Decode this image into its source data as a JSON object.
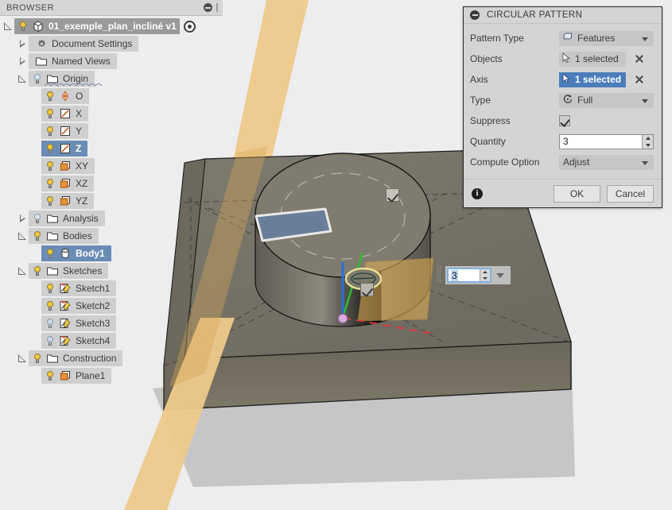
{
  "browser": {
    "header": {
      "title": "BROWSER",
      "minimize_icon": "minimize-icon",
      "grip_icon": "panel-grip-icon"
    },
    "tree": [
      {
        "label": "01_exemple_plan_incliné v1",
        "icon": "component-cube-icon",
        "state": "selected-root",
        "twisty": "open",
        "indent": 0,
        "bulb": "on",
        "eye": true
      },
      {
        "label": "Document Settings",
        "icon": "gear-icon",
        "twisty": "closed",
        "indent": 1,
        "bulb": "none"
      },
      {
        "label": "Named Views",
        "icon": "folder-icon",
        "twisty": "closed",
        "indent": 1,
        "bulb": "none"
      },
      {
        "label": "Origin",
        "icon": "folder-icon",
        "twisty": "open",
        "indent": 1,
        "bulb": "dim"
      },
      {
        "label": "O",
        "icon": "origin-point-icon",
        "twisty": "none",
        "indent": 2,
        "bulb": "on"
      },
      {
        "label": "X",
        "icon": "axis-icon",
        "twisty": "none",
        "indent": 2,
        "bulb": "on"
      },
      {
        "label": "Y",
        "icon": "axis-icon",
        "twisty": "none",
        "indent": 2,
        "bulb": "on"
      },
      {
        "label": "Z",
        "icon": "axis-icon",
        "twisty": "none",
        "indent": 2,
        "bulb": "on",
        "state": "selected"
      },
      {
        "label": "XY",
        "icon": "plane-icon",
        "twisty": "none",
        "indent": 2,
        "bulb": "on"
      },
      {
        "label": "XZ",
        "icon": "plane-icon",
        "twisty": "none",
        "indent": 2,
        "bulb": "on"
      },
      {
        "label": "YZ",
        "icon": "plane-icon",
        "twisty": "none",
        "indent": 2,
        "bulb": "on"
      },
      {
        "label": "Analysis",
        "icon": "folder-icon",
        "twisty": "closed",
        "indent": 1,
        "bulb": "dim"
      },
      {
        "label": "Bodies",
        "icon": "folder-icon",
        "twisty": "open",
        "indent": 1,
        "bulb": "on"
      },
      {
        "label": "Body1",
        "icon": "body-icon",
        "twisty": "none",
        "indent": 2,
        "bulb": "on",
        "state": "selected"
      },
      {
        "label": "Sketches",
        "icon": "folder-icon",
        "twisty": "open",
        "indent": 1,
        "bulb": "on"
      },
      {
        "label": "Sketch1",
        "icon": "sketch-icon",
        "twisty": "none",
        "indent": 2,
        "bulb": "on"
      },
      {
        "label": "Sketch2",
        "icon": "sketch-icon",
        "twisty": "none",
        "indent": 2,
        "bulb": "on"
      },
      {
        "label": "Sketch3",
        "icon": "sketch-icon",
        "twisty": "none",
        "indent": 2,
        "bulb": "off"
      },
      {
        "label": "Sketch4",
        "icon": "sketch-icon",
        "twisty": "none",
        "indent": 2,
        "bulb": "off"
      },
      {
        "label": "Construction",
        "icon": "folder-icon",
        "twisty": "open",
        "indent": 1,
        "bulb": "on"
      },
      {
        "label": "Plane1",
        "icon": "plane-icon",
        "twisty": "none",
        "indent": 2,
        "bulb": "on"
      }
    ]
  },
  "dialog": {
    "title": "CIRCULAR PATTERN",
    "collapse_icon": "collapse-icon",
    "rows": {
      "pattern_type": {
        "label": "Pattern Type",
        "value": "Features",
        "icon": "features-icon"
      },
      "objects": {
        "label": "Objects",
        "value": "1 selected",
        "icon": "cursor-arrow-icon",
        "clear_icon": "clear-x-icon"
      },
      "axis": {
        "label": "Axis",
        "value": "1 selected",
        "icon": "cursor-arrow-icon",
        "clear_icon": "clear-x-icon",
        "active": true
      },
      "type": {
        "label": "Type",
        "value": "Full",
        "icon": "full-rotation-icon"
      },
      "suppress": {
        "label": "Suppress",
        "checked": true
      },
      "quantity": {
        "label": "Quantity",
        "value": "3"
      },
      "compute_option": {
        "label": "Compute Option",
        "value": "Adjust"
      }
    },
    "footer": {
      "info_icon": "info-icon",
      "ok_label": "OK",
      "cancel_label": "Cancel"
    }
  },
  "viewport": {
    "float_input": {
      "value": "3",
      "spinner_icon": "spinner-icon",
      "dropdown_icon": "chevron-down-icon",
      "grip_icon": "drag-grip-icon"
    },
    "manipulators": [
      {
        "name": "quantity-checkbox-manipulator",
        "checked": true
      },
      {
        "name": "axis-checkbox-manipulator",
        "checked": true
      }
    ],
    "colors": {
      "background": "#ededee",
      "body": "#7a7468",
      "plane": "#e8c98c",
      "selected_face": "#6a7e99",
      "ground": "#c3c3c3",
      "axis_z": "#2b6fd4",
      "axis_y": "#2fb82f",
      "axis_x": "#d83a3a",
      "accent": "#4a7dba"
    }
  }
}
